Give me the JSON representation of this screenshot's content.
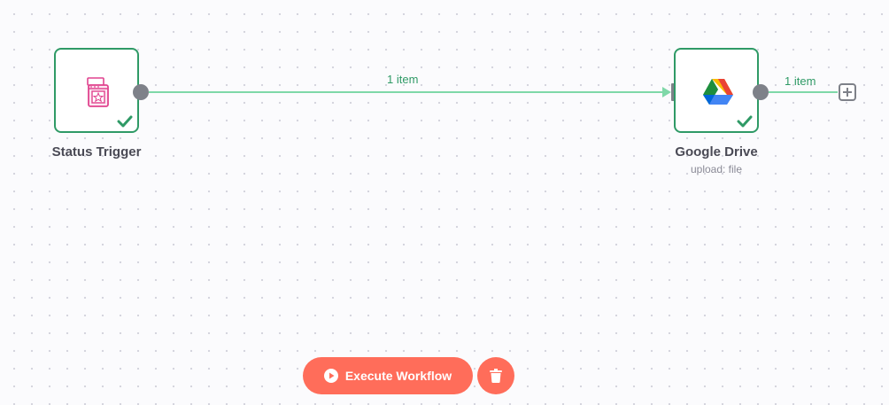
{
  "nodes": {
    "status_trigger": {
      "title": "Status Trigger",
      "status": "success",
      "icon": "status-trigger-icon"
    },
    "google_drive": {
      "title": "Google Drive",
      "subtitle": "upload: file",
      "status": "success",
      "icon": "google-drive-icon"
    }
  },
  "connections": {
    "trigger_to_drive_label": "1 item",
    "drive_output_label": "1 item"
  },
  "toolbar": {
    "execute_label": "Execute Workflow",
    "delete_icon": "trash-icon"
  },
  "colors": {
    "success": "#2f9a66",
    "connection": "#7fd8a8",
    "accent": "#ff6d5a",
    "handle": "#7e8189"
  }
}
